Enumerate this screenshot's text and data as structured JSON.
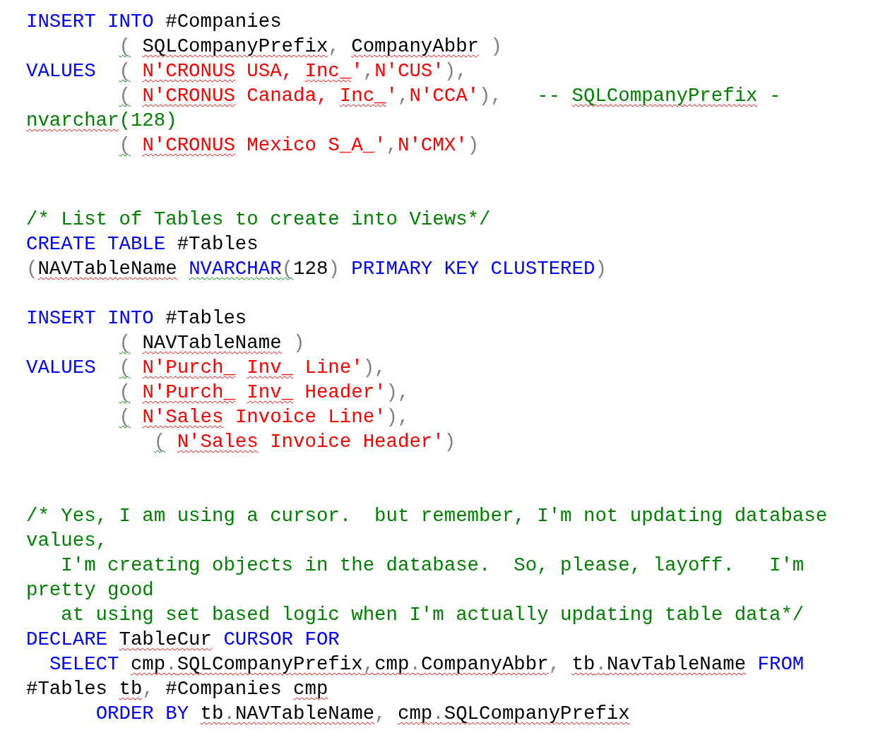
{
  "document": {
    "lines": [
      {
        "segments": [
          {
            "text": "INSERT INTO ",
            "kind": "keyword"
          },
          {
            "text": "#Companies",
            "kind": "identifier"
          }
        ]
      },
      {
        "segments": [
          {
            "text": "        ( ",
            "kind": "punctuation",
            "grammar": true
          },
          {
            "text": "SQLCompanyPrefix",
            "kind": "identifier",
            "spelling": true
          },
          {
            "text": ", ",
            "kind": "punctuation"
          },
          {
            "text": "CompanyAbbr",
            "kind": "identifier",
            "spelling": true
          },
          {
            "text": " )",
            "kind": "punctuation"
          }
        ]
      },
      {
        "segments": [
          {
            "text": "VALUES  ",
            "kind": "keyword"
          },
          {
            "text": "( ",
            "kind": "punctuation",
            "grammar": true
          },
          {
            "text": "N'CRONUS",
            "kind": "string",
            "spelling": true
          },
          {
            "text": " USA, ",
            "kind": "string"
          },
          {
            "text": "Inc_",
            "kind": "string",
            "spelling": true
          },
          {
            "text": "'",
            "kind": "string"
          },
          {
            "text": ",",
            "kind": "punctuation"
          },
          {
            "text": "N'CUS'",
            "kind": "string"
          },
          {
            "text": "),",
            "kind": "punctuation"
          }
        ]
      },
      {
        "segments": [
          {
            "text": "        ( ",
            "kind": "punctuation",
            "grammar": true
          },
          {
            "text": "N'CRONUS",
            "kind": "string",
            "spelling": true
          },
          {
            "text": " Canada, ",
            "kind": "string"
          },
          {
            "text": "Inc_",
            "kind": "string",
            "spelling": true
          },
          {
            "text": "'",
            "kind": "string"
          },
          {
            "text": ",",
            "kind": "punctuation"
          },
          {
            "text": "N'CCA'",
            "kind": "string"
          },
          {
            "text": "),   ",
            "kind": "punctuation"
          },
          {
            "text": "-- ",
            "kind": "comment"
          },
          {
            "text": "SQLCompanyPrefix",
            "kind": "comment",
            "spelling": true
          },
          {
            "text": " -",
            "kind": "comment"
          }
        ]
      },
      {
        "segments": [
          {
            "text": "nvarchar",
            "kind": "comment",
            "spelling": true
          },
          {
            "text": "(128)",
            "kind": "comment"
          }
        ]
      },
      {
        "segments": [
          {
            "text": "        ( ",
            "kind": "punctuation",
            "grammar": true
          },
          {
            "text": "N'CRONUS",
            "kind": "string",
            "spelling": true
          },
          {
            "text": " Mexico S_A_'",
            "kind": "string"
          },
          {
            "text": ",",
            "kind": "punctuation"
          },
          {
            "text": "N'CMX'",
            "kind": "string"
          },
          {
            "text": ")",
            "kind": "punctuation"
          }
        ]
      },
      {
        "kind": "blank"
      },
      {
        "kind": "blank"
      },
      {
        "segments": [
          {
            "text": "/* List of Tables to create into Views*/",
            "kind": "comment"
          }
        ]
      },
      {
        "segments": [
          {
            "text": "CREATE TABLE ",
            "kind": "keyword"
          },
          {
            "text": "#Tables",
            "kind": "identifier"
          }
        ]
      },
      {
        "segments": [
          {
            "text": "(",
            "kind": "punctuation"
          },
          {
            "text": "NAVTableName",
            "kind": "identifier",
            "spelling": true
          },
          {
            "text": " NVARCHAR",
            "kind": "keyword",
            "grammar": true
          },
          {
            "text": "(",
            "kind": "punctuation",
            "grammar": true
          },
          {
            "text": "128",
            "kind": "identifier"
          },
          {
            "text": ") ",
            "kind": "punctuation"
          },
          {
            "text": "PRIMARY KEY CLUSTERED",
            "kind": "keyword"
          },
          {
            "text": ")",
            "kind": "punctuation"
          }
        ]
      },
      {
        "kind": "blank"
      },
      {
        "segments": [
          {
            "text": "INSERT INTO ",
            "kind": "keyword"
          },
          {
            "text": "#Tables",
            "kind": "identifier"
          }
        ]
      },
      {
        "segments": [
          {
            "text": "        ( ",
            "kind": "punctuation",
            "grammar": true
          },
          {
            "text": "NAVTableName",
            "kind": "identifier",
            "spelling": true
          },
          {
            "text": " )",
            "kind": "punctuation"
          }
        ]
      },
      {
        "segments": [
          {
            "text": "VALUES  ",
            "kind": "keyword"
          },
          {
            "text": "( ",
            "kind": "punctuation",
            "grammar": true
          },
          {
            "text": "N'Purch_",
            "kind": "string",
            "spelling": true
          },
          {
            "text": " Inv_",
            "kind": "string",
            "spelling": true
          },
          {
            "text": " Line'",
            "kind": "string"
          },
          {
            "text": "),",
            "kind": "punctuation"
          }
        ]
      },
      {
        "segments": [
          {
            "text": "        ( ",
            "kind": "punctuation",
            "grammar": true
          },
          {
            "text": "N'Purch_",
            "kind": "string",
            "spelling": true
          },
          {
            "text": " Inv_",
            "kind": "string",
            "spelling": true
          },
          {
            "text": " Header'",
            "kind": "string"
          },
          {
            "text": "),",
            "kind": "punctuation"
          }
        ]
      },
      {
        "segments": [
          {
            "text": "        ( ",
            "kind": "punctuation",
            "grammar": true
          },
          {
            "text": "N'Sales",
            "kind": "string",
            "spelling": true
          },
          {
            "text": " Invoice Line'",
            "kind": "string"
          },
          {
            "text": "),",
            "kind": "punctuation"
          }
        ]
      },
      {
        "segments": [
          {
            "text": "           ( ",
            "kind": "punctuation",
            "grammar": true
          },
          {
            "text": "N'Sales",
            "kind": "string",
            "spelling": true
          },
          {
            "text": " Invoice Header'",
            "kind": "string"
          },
          {
            "text": ")",
            "kind": "punctuation"
          }
        ]
      },
      {
        "kind": "blank"
      },
      {
        "kind": "blank"
      },
      {
        "segments": [
          {
            "text": "/* Yes, I am using a cursor.  but remember, I'm not updating database",
            "kind": "comment"
          }
        ]
      },
      {
        "segments": [
          {
            "text": "values,",
            "kind": "comment"
          }
        ]
      },
      {
        "segments": [
          {
            "text": "   I'm creating objects in the database.  So, please, layoff.   I'm",
            "kind": "comment"
          }
        ]
      },
      {
        "segments": [
          {
            "text": "pretty good",
            "kind": "comment"
          }
        ]
      },
      {
        "segments": [
          {
            "text": "   at using set based logic when I'm actually updating table data*/",
            "kind": "comment"
          }
        ]
      },
      {
        "segments": [
          {
            "text": "DECLARE ",
            "kind": "keyword"
          },
          {
            "text": "TableCur",
            "kind": "identifier",
            "spelling": true
          },
          {
            "text": " CURSOR FOR",
            "kind": "keyword"
          }
        ]
      },
      {
        "segments": [
          {
            "text": "  SELECT ",
            "kind": "keyword"
          },
          {
            "text": "cmp",
            "kind": "identifier",
            "spelling": true
          },
          {
            "text": ".",
            "kind": "punctuation",
            "spelling": true
          },
          {
            "text": "SQLCompanyPrefix",
            "kind": "identifier",
            "spelling": true
          },
          {
            "text": ",",
            "kind": "punctuation",
            "spelling": true
          },
          {
            "text": "cmp",
            "kind": "identifier",
            "spelling": true
          },
          {
            "text": ".",
            "kind": "punctuation",
            "spelling": true
          },
          {
            "text": "CompanyAbbr",
            "kind": "identifier",
            "spelling": true
          },
          {
            "text": ", ",
            "kind": "punctuation"
          },
          {
            "text": "tb",
            "kind": "identifier",
            "spelling": true
          },
          {
            "text": ".",
            "kind": "punctuation",
            "spelling": true
          },
          {
            "text": "NavTableName",
            "kind": "identifier",
            "spelling": true
          },
          {
            "text": " FROM",
            "kind": "keyword"
          }
        ]
      },
      {
        "segments": [
          {
            "text": "#Tables ",
            "kind": "identifier"
          },
          {
            "text": "tb",
            "kind": "identifier",
            "spelling": true
          },
          {
            "text": ", ",
            "kind": "punctuation"
          },
          {
            "text": "#Companies ",
            "kind": "identifier"
          },
          {
            "text": "cmp",
            "kind": "identifier",
            "spelling": true
          }
        ]
      },
      {
        "segments": [
          {
            "text": "      ORDER BY ",
            "kind": "keyword"
          },
          {
            "text": "tb",
            "kind": "identifier",
            "spelling": true
          },
          {
            "text": ".",
            "kind": "punctuation",
            "spelling": true
          },
          {
            "text": "NAVTableName",
            "kind": "identifier",
            "spelling": true
          },
          {
            "text": ", ",
            "kind": "punctuation"
          },
          {
            "text": "cmp",
            "kind": "identifier",
            "spelling": true
          },
          {
            "text": ".",
            "kind": "punctuation",
            "spelling": true
          },
          {
            "text": "SQLCompanyPrefix",
            "kind": "identifier",
            "spelling": true
          }
        ]
      }
    ]
  }
}
